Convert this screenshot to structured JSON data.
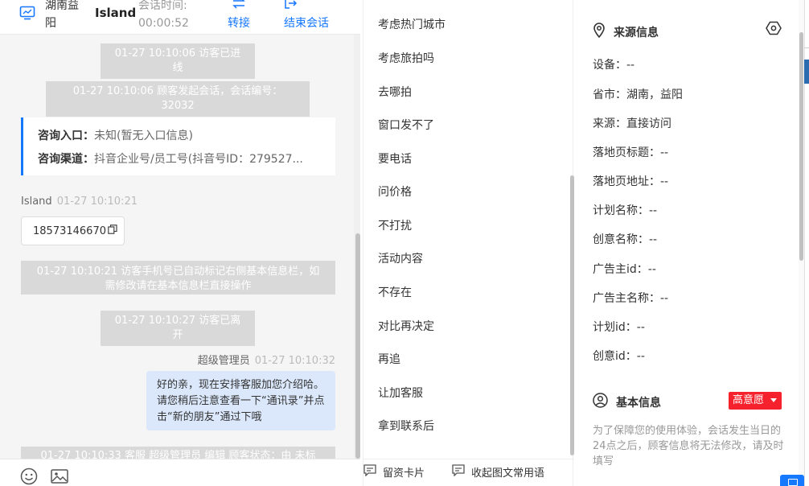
{
  "header": {
    "location": "湖南益阳",
    "visitor_name": "Island",
    "session_time_label": "会话时间:",
    "session_time_value": "00:00:52",
    "transfer_label": "转接",
    "end_session_label": "结束会话"
  },
  "chat": {
    "sys_entered": "01-27 10:10:06 访客已进线",
    "sys_started": "01-27 10:10:06 顾客发起会话，会话编号：32032",
    "entry_label": "咨询入口：",
    "entry_value": "未知(暂无入口信息)",
    "channel_label": "咨询渠道：",
    "channel_value": "抖音企业号/员工号(抖音号ID：279527...",
    "visitor_sender": "Island",
    "visitor_time": "01-27 10:10:21",
    "visitor_phone": "18573146670",
    "sys_phone_note": "01-27 10:10:21 访客手机号已自动标记右侧基本信息栏，如需修改请在基本信息栏直接操作",
    "sys_left": "01-27 10:10:27 访客已离开",
    "agent_sender": "超级管理员",
    "agent_time": "01-27 10:10:32",
    "agent_message": "好的亲，现在安排客服加您介绍哈。请您稍后注意查看一下“通讯录”并点击“新的朋友”通过下哦",
    "sys_partial": "01-27 10:10:33 客服 超级管理员 编辑 顾客状态：由 未标"
  },
  "chat_footer": {
    "emoji_icon": "smile-icon",
    "image_icon": "image-icon"
  },
  "quick_replies": {
    "items": [
      "考虑热门城市",
      "考虑旅拍吗",
      "去哪拍",
      "窗口发不了",
      "要电话",
      "问价格",
      "不打扰",
      "活动内容",
      "不存在",
      "对比再决定",
      "再追",
      "让加客服",
      "拿到联系后"
    ],
    "footer_card": "留资卡片",
    "footer_collapse": "收起图文常用语"
  },
  "info": {
    "source_title": "来源信息",
    "rows": [
      {
        "label": "设备：",
        "value": "--"
      },
      {
        "label": "省市：",
        "value": "湖南，益阳"
      },
      {
        "label": "来源：",
        "value": "直接访问"
      },
      {
        "label": "落地页标题：",
        "value": "--"
      },
      {
        "label": "落地页地址：",
        "value": "--"
      },
      {
        "label": "计划名称：",
        "value": "--"
      },
      {
        "label": "创意名称：",
        "value": "--"
      },
      {
        "label": "广告主id：",
        "value": "--"
      },
      {
        "label": "广告主名称：",
        "value": "--"
      },
      {
        "label": "计划id：",
        "value": "--"
      },
      {
        "label": "创意id：",
        "value": "--"
      }
    ],
    "basic_title": "基本信息",
    "intent_badge": "高意愿",
    "notice": "为了保障您的使用体验，会话发生当日的24点之后，顾客信息将无法修改，请及时填写"
  },
  "colors": {
    "accent": "#1677ff",
    "badge_red": "#f5222d",
    "agent_bubble": "#dbe8fb",
    "system_msg": "#d9d9d9"
  }
}
